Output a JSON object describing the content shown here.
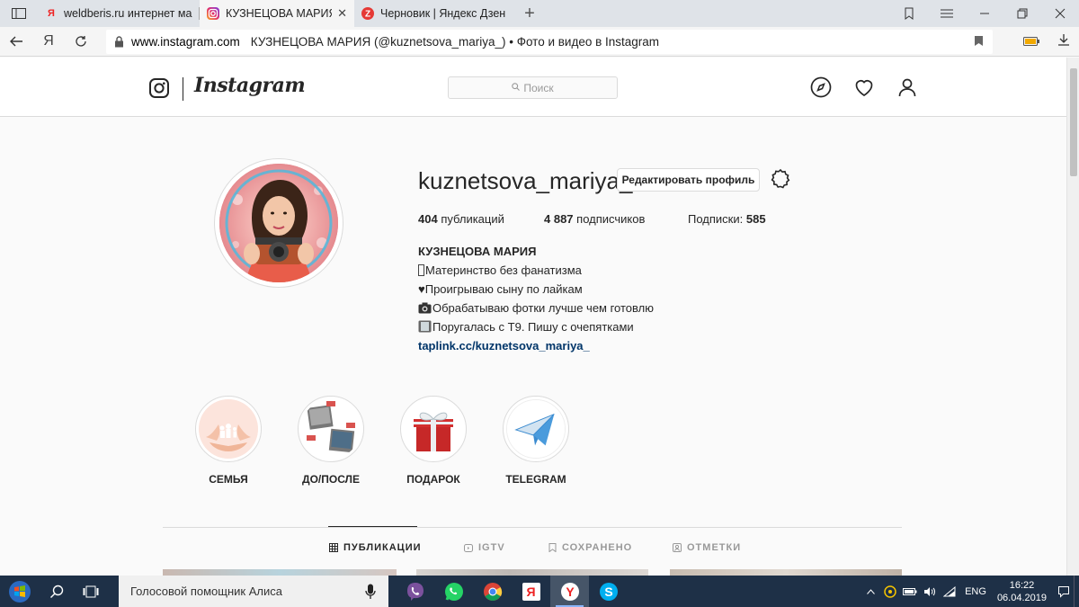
{
  "browser": {
    "tabs": [
      {
        "label": "weldberis.ru интернет мага",
        "favicon": "Я",
        "active": false
      },
      {
        "label": "КУЗНЕЦОВА МАРИЯ (@",
        "favicon": "instagram-icon",
        "active": true
      },
      {
        "label": "Черновик | Яндекс Дзен",
        "favicon": "zen-icon",
        "active": false
      }
    ],
    "yandex_letter": "Я",
    "url_host": "www.instagram.com",
    "page_title": "КУЗНЕЦОВА МАРИЯ (@kuznetsova_mariya_) • Фото и видео в Instagram"
  },
  "instagram": {
    "wordmark": "Instagram",
    "search_placeholder": "Поиск",
    "profile": {
      "username": "kuznetsova_mariya_",
      "edit_label": "Редактировать профиль",
      "posts_count": "404",
      "posts_label": " публикаций",
      "followers_count": "4 887",
      "followers_label": " подписчиков",
      "following_label": "Подписки: ",
      "following_count": "585",
      "full_name": "КУЗНЕЦОВА МАРИЯ",
      "bio": [
        "Материнство без фанатизма",
        "Проигрываю сыну по лайкам",
        "Обрабатываю фотки лучше чем готовлю",
        "Поругалась с Т9. Пишу с очепятками"
      ],
      "bio_prefix": [
        "",
        "♥",
        "",
        ""
      ],
      "link": "taplink.cc/kuznetsova_mariya_"
    },
    "highlights": [
      {
        "label": "СЕМЬЯ"
      },
      {
        "label": "ДО/ПОСЛЕ"
      },
      {
        "label": "ПОДАРОК"
      },
      {
        "label": "TELEGRAM"
      }
    ],
    "tabs": [
      {
        "label": "ПУБЛИКАЦИИ",
        "active": true
      },
      {
        "label": "IGTV",
        "active": false
      },
      {
        "label": "СОХРАНЕНО",
        "active": false
      },
      {
        "label": "ОТМЕТКИ",
        "active": false
      }
    ]
  },
  "taskbar": {
    "search_text": "Голосовой помощник Алиса",
    "yandex_letter": "Я",
    "lang": "ENG",
    "time": "16:22",
    "date": "06.04.2019"
  },
  "colors": {
    "link": "#003569",
    "border": "#dbdbdb",
    "text": "#262626",
    "taskbar": "#1e3047"
  }
}
